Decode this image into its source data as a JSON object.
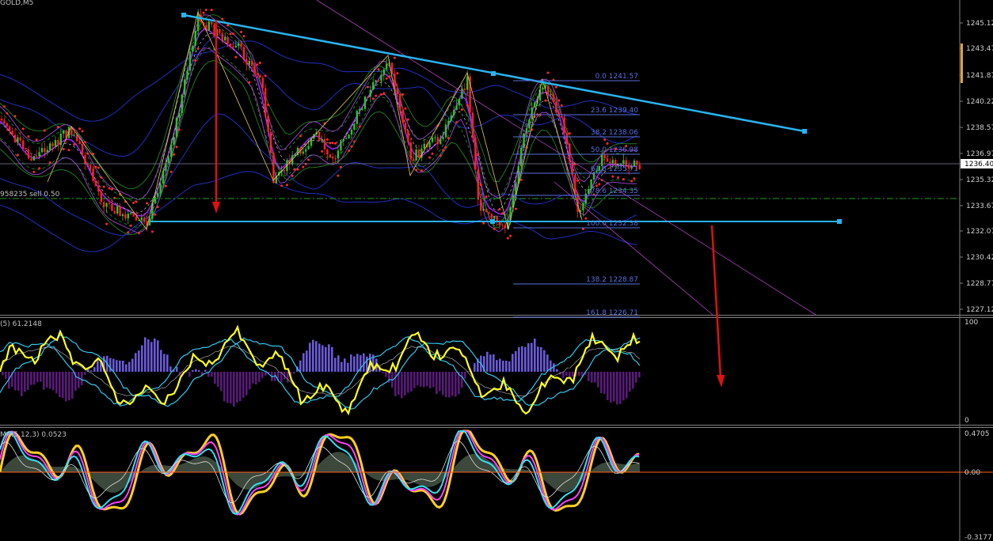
{
  "symbol": "GOLD,M5",
  "order_line_label": "958235 sell 0.50",
  "price_axis": {
    "labels": [
      "1245.12",
      "1243.47",
      "1241.87",
      "1240.22",
      "1238.57",
      "1236.97",
      "1235.32",
      "1233.67",
      "1232.07",
      "1230.42",
      "1228.77",
      "1227.12"
    ],
    "current_price": "1236.40"
  },
  "fibonacci": {
    "levels": [
      "0.0 1241.57",
      "23.6 1239.40",
      "38.2 1238.06",
      "50.0 1236.98",
      "61.8 1235.71",
      "78.6 1234.35",
      "100.0 1232.38",
      "138.2 1228.87",
      "161.8 1226.71"
    ]
  },
  "indicator1": {
    "label": "(5) 61.2148",
    "scale_top": "100",
    "scale_bottom": "0"
  },
  "indicator2": {
    "label": "MA(5,12,3) 0.0523",
    "scale_top": "0.4705",
    "scale_zero": "0.00",
    "scale_bottom": "-0.3177"
  },
  "colors": {
    "background": "#000000",
    "trendline": "#28b4f0",
    "bull_candle": "#2ec02e",
    "bear_candle": "#ff2020",
    "parabolic_sar": "#ff2a2a",
    "ma_purple": "#a020f0",
    "arrow": "#e01010",
    "fib": "#5a6fe0",
    "osc_yellow": "#ffff20",
    "osc_cyan": "#30c8f0",
    "hist_blue": "#6a5ad8",
    "hist_purple": "#5a1a7a"
  }
}
